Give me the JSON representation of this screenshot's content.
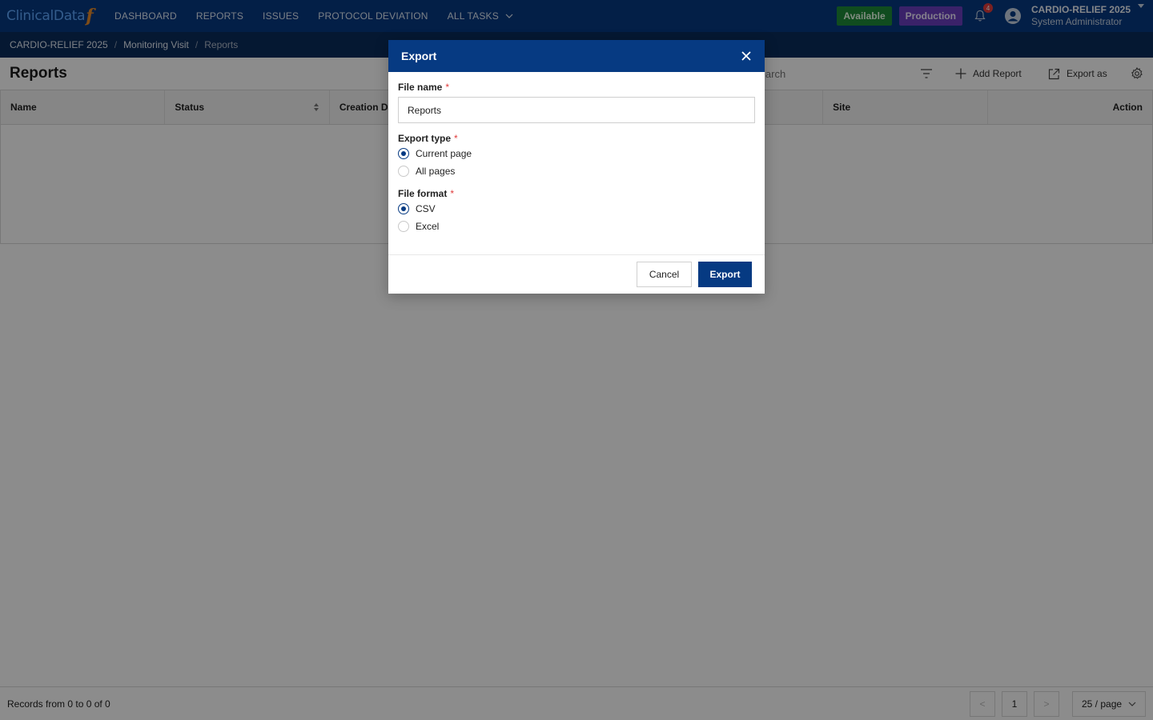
{
  "nav": {
    "logo_text": "ClinicalData",
    "logo_mark": "f",
    "items": [
      {
        "label": "DASHBOARD"
      },
      {
        "label": "REPORTS"
      },
      {
        "label": "ISSUES"
      },
      {
        "label": "PROTOCOL DEVIATION"
      },
      {
        "label": "ALL TASKS"
      }
    ],
    "status_available": "Available",
    "status_environment": "Production",
    "notification_count": "4",
    "user_project": "CARDIO-RELIEF 2025",
    "user_role": "System Administrator"
  },
  "breadcrumb": {
    "items": [
      "CARDIO-RELIEF 2025",
      "Monitoring Visit",
      "Reports"
    ],
    "separator": "/"
  },
  "page": {
    "title": "Reports",
    "search_placeholder": "Search",
    "add_report_label": "Add Report",
    "export_as_label": "Export as"
  },
  "table": {
    "columns": [
      "Name",
      "Status",
      "Creation Date",
      "",
      "",
      "Site",
      "Action"
    ]
  },
  "footer": {
    "records_text": "Records from 0 to 0 of 0",
    "prev": "<",
    "current_page": "1",
    "next": ">",
    "page_size": "25 / page"
  },
  "modal": {
    "title": "Export",
    "file_name_label": "File name",
    "file_name_value": "Reports",
    "required_mark": "*",
    "export_type_label": "Export type",
    "export_type_options": [
      {
        "label": "Current page",
        "checked": true
      },
      {
        "label": "All pages",
        "checked": false
      }
    ],
    "file_format_label": "File format",
    "file_format_options": [
      {
        "label": "CSV",
        "checked": true
      },
      {
        "label": "Excel",
        "checked": false
      }
    ],
    "cancel_label": "Cancel",
    "export_label": "Export"
  },
  "colors": {
    "nav_bg": "#063a82",
    "breadcrumb_bg": "#0a2c5c",
    "available": "#1e8a3a",
    "production": "#6a3fbf",
    "primary_button": "#063a82"
  }
}
